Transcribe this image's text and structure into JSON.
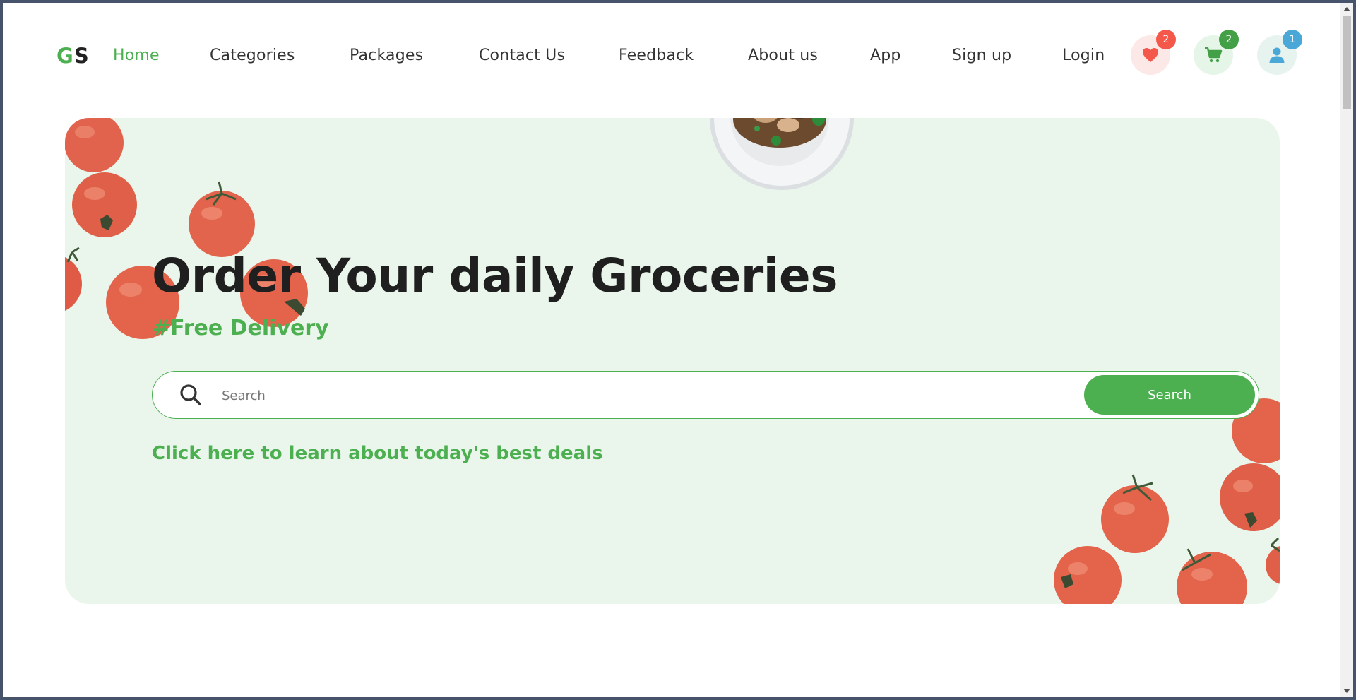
{
  "logo": {
    "first": "G",
    "second": "S"
  },
  "nav": {
    "links": [
      {
        "label": "Home",
        "active": true
      },
      {
        "label": "Categories"
      },
      {
        "label": "Packages"
      },
      {
        "label": "Contact Us"
      },
      {
        "label": "Feedback"
      },
      {
        "label": "About us"
      },
      {
        "label": "App"
      },
      {
        "label": "Sign up"
      },
      {
        "label": "Login"
      }
    ],
    "wishlist_count": "2",
    "cart_count": "2",
    "user_count": "1"
  },
  "hero": {
    "title": "Order Your daily Groceries",
    "subtitle": "#Free Delivery",
    "search_placeholder": "Search",
    "search_button": "Search",
    "deals_link": "Click here to learn about today's best deals"
  },
  "colors": {
    "accent": "#4caf50",
    "hero_bg": "#eaf6ec",
    "wish_badge": "#f4584b",
    "cart_badge": "#43a047",
    "user_badge": "#4aa8d8"
  },
  "icons": [
    "heart-icon",
    "cart-icon",
    "user-icon",
    "search-icon"
  ]
}
